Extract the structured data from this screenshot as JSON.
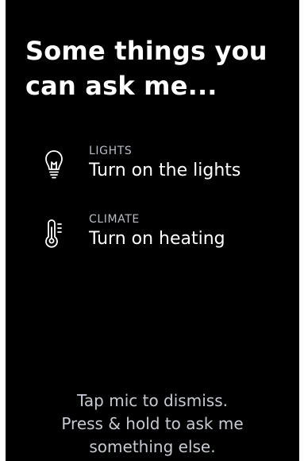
{
  "header": {
    "title_line1": "Some things you",
    "title_line2": "can ask me..."
  },
  "suggestions": [
    {
      "category": "LIGHTS",
      "phrase": "Turn on the lights",
      "icon": "lightbulb-icon"
    },
    {
      "category": "CLIMATE",
      "phrase": "Turn on heating",
      "icon": "thermometer-icon"
    }
  ],
  "hint": {
    "line1": "Tap mic to dismiss.",
    "line2": "Press & hold to ask me",
    "line3": "something else."
  },
  "colors": {
    "background": "#000000",
    "text": "#ffffff",
    "secondary_text": "#b8bcc6"
  }
}
